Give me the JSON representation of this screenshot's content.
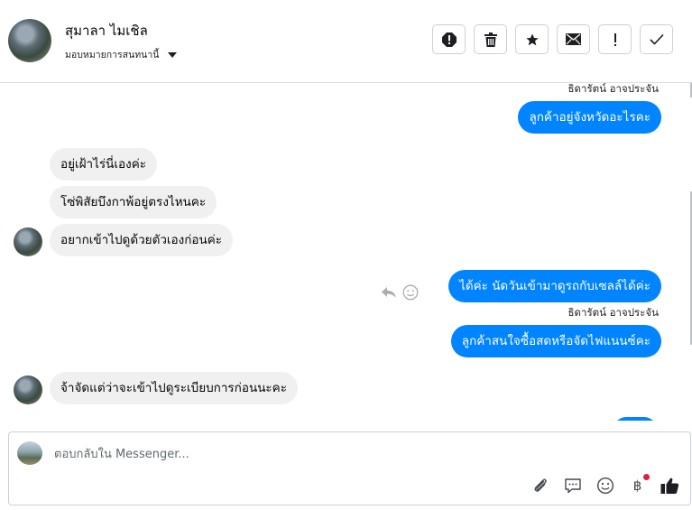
{
  "header": {
    "user_name": "สุมาลา ไมเชิล",
    "assign_label": "มอบหมายการสนทนานี้",
    "actions": [
      "spam",
      "delete",
      "star",
      "unread",
      "important",
      "done"
    ]
  },
  "thread": {
    "messages": [
      {
        "dir": "out",
        "sender": "ธิดารัตน์ อาจประจัน",
        "text": "ลูกค้าอยู่จังหวัดอะไรคะ"
      },
      {
        "dir": "in",
        "text": "อยู่เฝ้าไร่นี่เองค่ะ"
      },
      {
        "dir": "in",
        "text": "โซ่พิสัยบึงกาพ้อยู่ตรงไหนคะ"
      },
      {
        "dir": "in",
        "text": "อยากเข้าไปดูด้วยตัวเองก่อนค่ะ"
      },
      {
        "dir": "out",
        "text": "ได้ค่ะ นัดวันเข้ามาดูรถกับเซลล์ได้ค่ะ"
      },
      {
        "dir": "out",
        "sender": "ธิดารัตน์ อาจประจัน",
        "text": "ลูกค้าสนใจซื้อสดหรือจัดไฟแนนซ์คะ"
      },
      {
        "dir": "in",
        "text": "จ้าจัดแต่ว่าจะเข้าไปดูระเบียบการก่อนนะคะ"
      }
    ]
  },
  "composer": {
    "placeholder": "ตอบกลับใน Messenger...",
    "tools": [
      "paperclip-icon",
      "comment-icon",
      "smile-icon",
      "baht-icon",
      "thumbs-up-icon"
    ],
    "baht_symbol": "฿"
  },
  "colors": {
    "outgoing": "#0084ff",
    "incoming": "#f0f0f0"
  }
}
